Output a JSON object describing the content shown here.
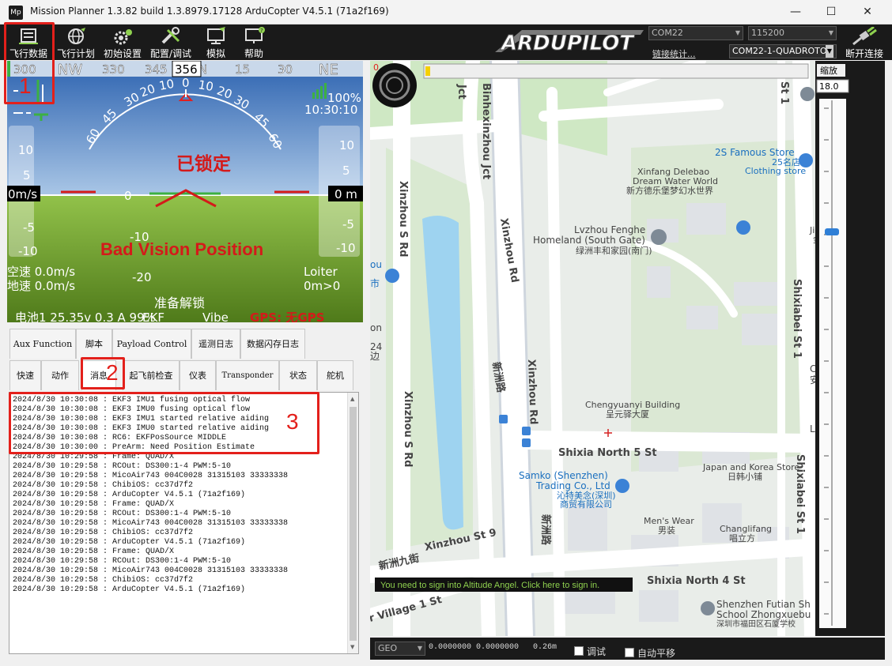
{
  "window": {
    "title": "Mission Planner 1.3.82 build 1.3.8979.17128 ArduCopter V4.5.1 (71a2f169)",
    "icon_text": "Mp",
    "minimize": "—",
    "maximize": "☐",
    "close": "✕"
  },
  "toolbar": {
    "flight_data": "飞行数据",
    "flight_plan": "飞行计划",
    "initial_setup": "初始设置",
    "config_tuning": "配置/调试",
    "simulation": "模拟",
    "help": "帮助",
    "logo": "ARDUPILOT",
    "port": "COM22",
    "baud": "115200",
    "link_stats": "链接统计...",
    "connection": "COM22-1-QUADROTOR",
    "disconnect": "断开连接"
  },
  "hud": {
    "compass_labels": [
      "300",
      "NW",
      "330",
      "345",
      "356",
      "N",
      "15",
      "30",
      "NE"
    ],
    "heading": "356",
    "pitch_left": [
      "10",
      "5",
      "0",
      "-5",
      "-10"
    ],
    "pitch_right": [
      "10",
      "5",
      "0",
      "-5",
      "-10"
    ],
    "pitch_center": [
      "-10",
      "-20"
    ],
    "roll_labels": [
      "60",
      "45",
      "30",
      "20",
      "10",
      "0",
      "10",
      "20",
      "30",
      "45",
      "60"
    ],
    "airspeed_box": "0m/s",
    "alt_box": "0 m",
    "battery_pct": "100%",
    "time": "10:30:10",
    "status_locked": "已锁定",
    "status_message": "Bad Vision Position",
    "airspeed": "空速 0.0m/s",
    "groundspeed": "地速 0.0m/s",
    "mode": "Loiter",
    "wp_info": "0m>0",
    "prearm": "准备解锁",
    "battery": "电池1 25.35v 0.3 A 99%",
    "ekf": "EKF",
    "vibe": "Vibe",
    "gps": "GPS: 无GPS"
  },
  "tabs_row1": [
    "Aux Function",
    "脚本",
    "Payload Control",
    "遥测日志",
    "数据闪存日志"
  ],
  "tabs_row2": [
    "快速",
    "动作",
    "消息",
    "起飞前检查",
    "仪表",
    "Transponder",
    "状态",
    "舵机"
  ],
  "messages": [
    "2024/8/30 10:30:08 : EKF3 IMU1 fusing optical flow",
    "2024/8/30 10:30:08 : EKF3 IMU0 fusing optical flow",
    "2024/8/30 10:30:08 : EKF3 IMU1 started relative aiding",
    "2024/8/30 10:30:08 : EKF3 IMU0 started relative aiding",
    "2024/8/30 10:30:08 : RC6: EKFPosSource MIDDLE",
    "2024/8/30 10:30:00 : PreArm: Need Position Estimate",
    "2024/8/30 10:29:58 : Frame: QUAD/X",
    "2024/8/30 10:29:58 : RCOut: DS300:1-4 PWM:5-10",
    "2024/8/30 10:29:58 : MicoAir743 004C0028 31315103 33333338",
    "2024/8/30 10:29:58 : ChibiOS: cc37d7f2",
    "2024/8/30 10:29:58 : ArduCopter V4.5.1 (71a2f169)",
    "2024/8/30 10:29:58 : Frame: QUAD/X",
    "2024/8/30 10:29:58 : RCOut: DS300:1-4 PWM:5-10",
    "2024/8/30 10:29:58 : MicoAir743 004C0028 31315103 33333338",
    "2024/8/30 10:29:58 : ChibiOS: cc37d7f2",
    "2024/8/30 10:29:58 : ArduCopter V4.5.1 (71a2f169)",
    "2024/8/30 10:29:58 : Frame: QUAD/X",
    "2024/8/30 10:29:58 : RCOut: DS300:1-4 PWM:5-10",
    "2024/8/30 10:29:58 : MicoAir743 004C0028 31315103 33333338",
    "2024/8/30 10:29:58 : ChibiOS: cc37d7f2",
    "2024/8/30 10:29:58 : ArduCopter V4.5.1 (71a2f169)"
  ],
  "map": {
    "zoom_label": "缩放",
    "zoom_value": "18.0",
    "zero_marker": "0",
    "roads": {
      "binhexinzhou": "Binhexinzhou Jct",
      "jct": "Jct",
      "xinzhou_rd_1": "Xinzhou Rd",
      "xinzhou_rd_2": "Xinzhou Rd",
      "xinzhou_s_rd_1": "Xinzhou S Rd",
      "xinzhou_s_rd_2": "Xinzhou S Rd",
      "shixiabei_st1_a": "Shixiabei St 1",
      "shixiabei_st1_b": "Shixiabei St 1",
      "st1_top": "St 1",
      "shixia_n5": "Shixia North 5 St",
      "shixia_n4": "Shixia North 4 St",
      "xinzhou_st9": "Xinzhou St 9",
      "xinzhou_9_cn": "新洲九街",
      "xinzhou_rd_cn_1": "新洲路",
      "xinzhou_rd_cn_2": "新洲路",
      "village1": "r Village 1 St"
    },
    "pois": {
      "famous_store_en": "2S Famous Store",
      "famous_store_cn": "25名店",
      "famous_store_sub": "Clothing store",
      "xinfang_en1": "Xinfang Delebao",
      "xinfang_en2": "Dream Water World",
      "xinfang_cn": "新方德乐堡梦幻水世界",
      "lvzhou_en1": "Lvzhou Fenghe",
      "lvzhou_en2": "Homeland (South Gate)",
      "lvzhou_cn": "绿洲丰和家园(南门)",
      "jinli_en": "Jinli Su",
      "jinli_cn": "金利",
      "chengyuanyi_en": "Chengyuanyi Building",
      "chengyuanyi_cn": "呈元驿大厦",
      "samko_en1": "Samko (Shenzhen)",
      "samko_en2": "Trading Co., Ltd",
      "samko_cn1": "沁特美念(深圳)",
      "samko_cn2": "商贸有限公司",
      "japan_korea_en": "Japan and Korea Store",
      "japan_korea_cn": "日韩小铺",
      "mens_wear_en": "Men's Wear",
      "mens_wear_cn": "男装",
      "changlifang_en": "Changlifang",
      "changlifang_cn": "唱立方",
      "shenzhen_futian_en1": "Shenzhen Futian Sh",
      "shenzhen_futian_en2": "School Zhongxuebu",
      "shenzhen_futian_cn": "深圳市福田区石厦学校",
      "left_frag_1": "ou",
      "left_frag_2": "市",
      "left_frag_3": "on",
      "left_frag_4": "24",
      "left_frag_5": "边",
      "right_frag_1": "C",
      "right_frag_2": "安",
      "right_frag_3": "Liu"
    },
    "banner": "You need to sign into Altitude Angel. Click here to sign in.",
    "coord_system": "GEO",
    "coords": "0.0000000 0.0000000",
    "distance": "0.26m",
    "debug_label": "调试",
    "autopan_label": "自动平移"
  },
  "annotations": [
    "1",
    "2",
    "3"
  ],
  "colors": {
    "accent_red": "#e3201b",
    "hud_red": "#d41a1a",
    "sky": "#5c8fc6",
    "ground": "#6e9a2c",
    "water": "#9ed3f0",
    "road": "#ffffff",
    "park": "#cfe8c4"
  }
}
